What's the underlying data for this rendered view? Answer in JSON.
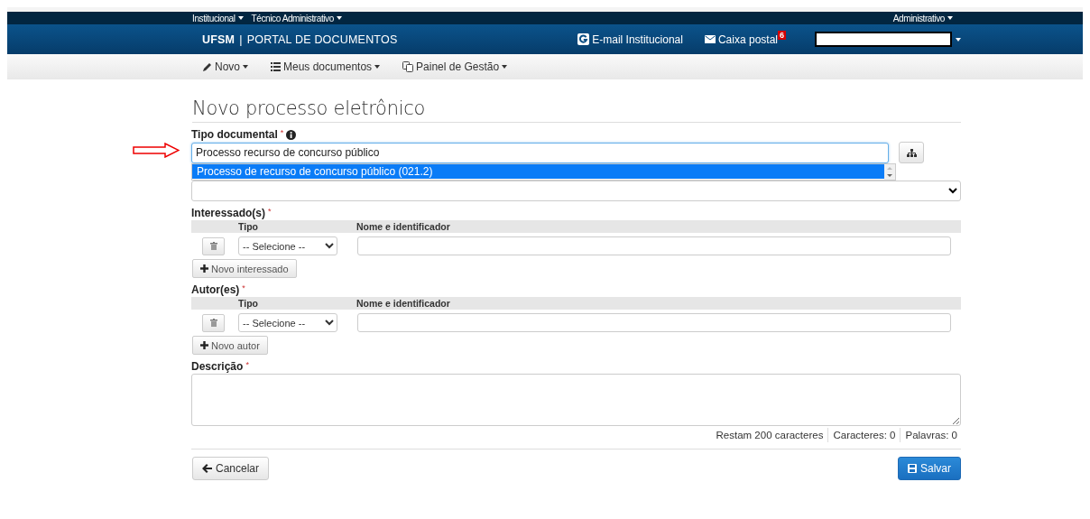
{
  "top_bar": {
    "left_menus": [
      {
        "label": "Institucional"
      },
      {
        "label": "Técnico Administrativo"
      }
    ],
    "right_menu": {
      "label": "Administrativo"
    }
  },
  "header": {
    "brand": "UFSM",
    "separator": "|",
    "title": "PORTAL DE DOCUMENTOS",
    "email_link": "E-mail Institucional",
    "mail_link": {
      "label": "Caixa postal",
      "badge": "6"
    }
  },
  "nav": [
    {
      "label": "Novo"
    },
    {
      "label": "Meus documentos"
    },
    {
      "label": "Painel de Gestão"
    }
  ],
  "page_title": "Novo processo eletrônico",
  "tipo_documental": {
    "label": "Tipo documental",
    "required_mark": "*",
    "value": "Processo recurso de concurso público",
    "suggestions": [
      {
        "label": "Processo de recurso de concurso público (021.2)",
        "selected": true
      }
    ]
  },
  "sections": [
    {
      "label": "Interessado(s)",
      "required_mark": "*",
      "columns": [
        "Tipo",
        "Nome e identificador"
      ],
      "rows": [
        {
          "tipo": "-- Selecione --"
        }
      ],
      "add_button": "Novo interessado"
    },
    {
      "label": "Autor(es)",
      "required_mark": "*",
      "columns": [
        "Tipo",
        "Nome e identificador"
      ],
      "rows": [
        {
          "tipo": "-- Selecione --"
        }
      ],
      "add_button": "Novo autor"
    }
  ],
  "descricao": {
    "label": "Descrição",
    "required_mark": "*",
    "counters": [
      "Restam 200 caracteres",
      "Caracteres: 0",
      "Palavras: 0"
    ]
  },
  "buttons": [
    {
      "label": "Cancelar",
      "kind": "default"
    },
    {
      "label": "Salvar",
      "kind": "primary"
    }
  ]
}
